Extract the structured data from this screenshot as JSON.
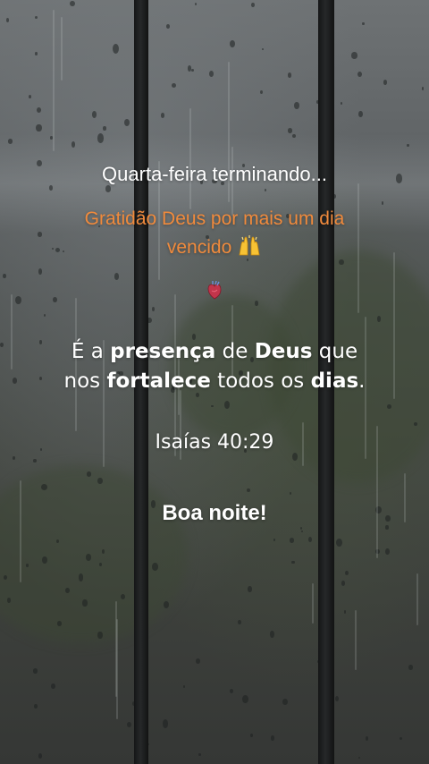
{
  "story": {
    "line1": "Quarta-feira terminando...",
    "line2_text": "Gratidão Deus por mais um dia",
    "line2_text_b": "vencido",
    "line2_emoji_icon": "raising-hands-icon",
    "heart_icon": "anatomical-heart-icon",
    "quote": {
      "p1": "É a ",
      "b1": "presença",
      "p2": " de ",
      "b2": "Deus",
      "p3": " que",
      "p4": "nos ",
      "b3": "fortalece",
      "p5": " todos os ",
      "b4": "dias",
      "p6": "."
    },
    "reference": "Isaías 40:29",
    "closing": "Boa noite!"
  },
  "colors": {
    "primary_text": "#ffffff",
    "accent_text": "#f08a3c"
  }
}
